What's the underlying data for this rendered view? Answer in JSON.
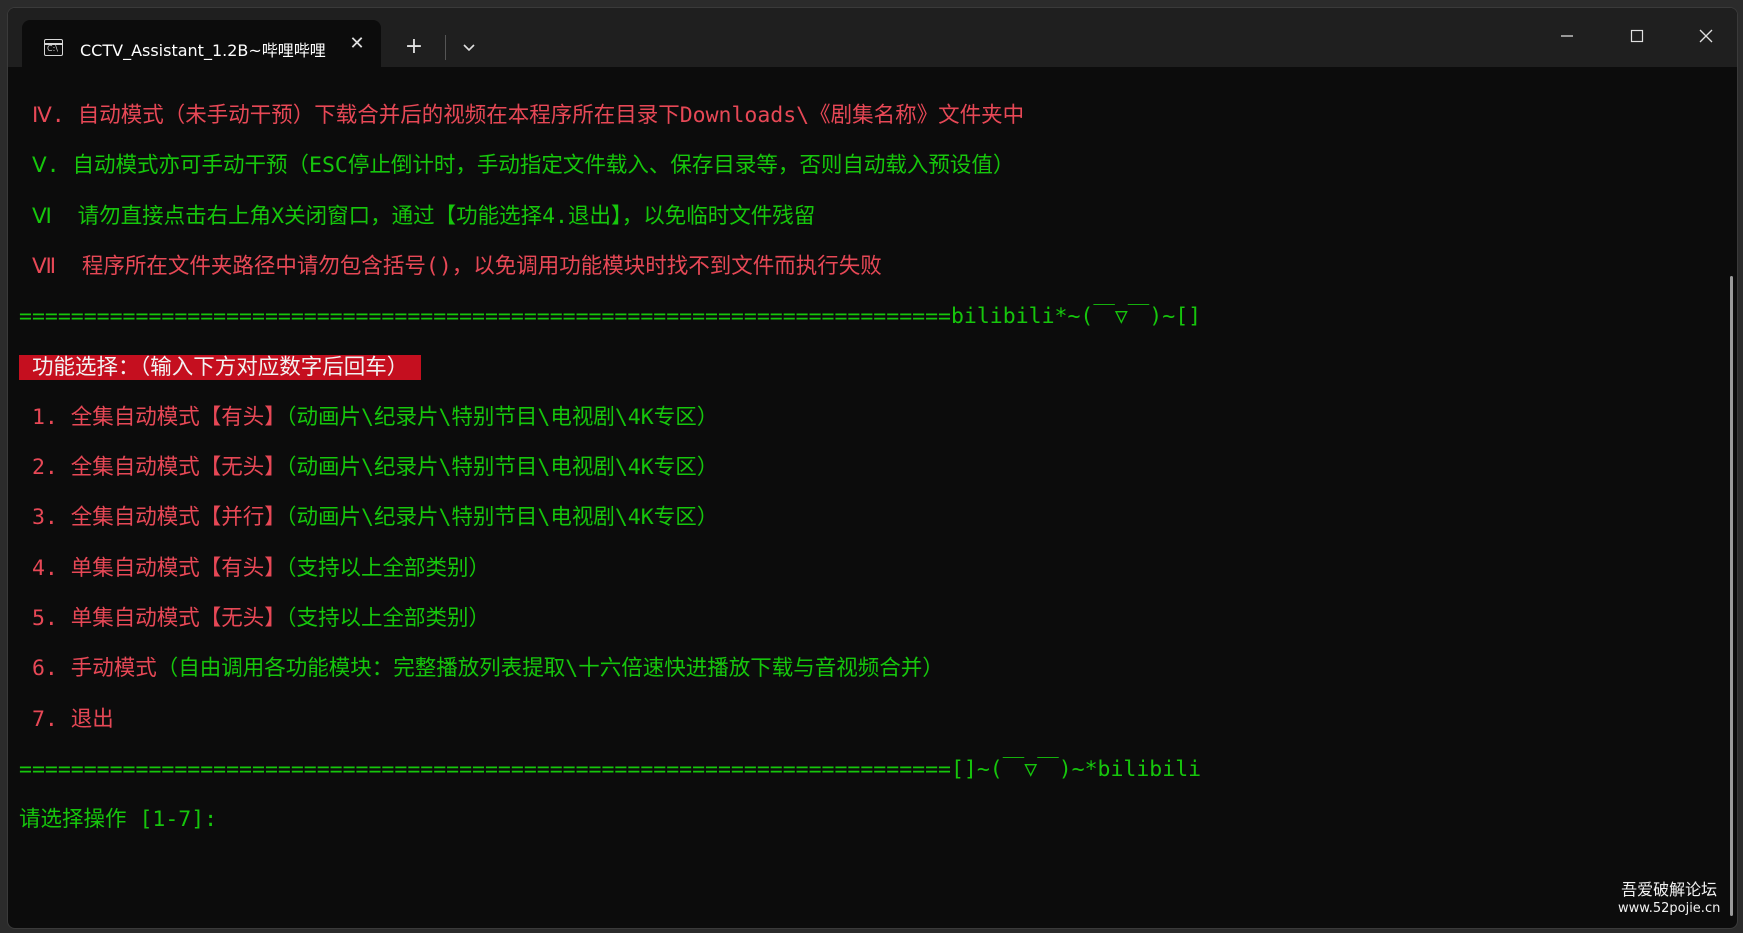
{
  "window": {
    "tab_title": "CCTV_Assistant_1.2B~哔哩哔哩",
    "tab_icon_text": "C:\\"
  },
  "terminal": {
    "lines": [
      {
        "segments": [
          {
            "text": " Ⅳ. ",
            "color": "r"
          },
          {
            "text": "自动模式（未手动干预）下载合并后的视频在本程序所在目录下Downloads\\《剧集名称》文件夹中",
            "color": "r"
          }
        ]
      },
      {
        "segments": [
          {
            "text": " Ⅴ. ",
            "color": "g"
          },
          {
            "text": "自动模式亦可手动干预（ESC停止倒计时，手动指定文件载入、保存目录等，否则自动载入预设值）",
            "color": "g"
          }
        ]
      },
      {
        "segments": [
          {
            "text": " Ⅵ  ",
            "color": "g"
          },
          {
            "text": "请勿直接点击右上角X关闭窗口，通过【功能选择4.退出】，以免临时文件残留",
            "color": "g"
          }
        ]
      },
      {
        "segments": [
          {
            "text": " Ⅶ  ",
            "color": "r"
          },
          {
            "text": "程序所在文件夹路径中请勿包含括号()，以免调用功能模块时找不到文件而执行失败",
            "color": "r"
          }
        ]
      },
      {
        "segments": [
          {
            "text": "========================================================================bilibili*~(￣▽￣)~[]",
            "color": "g"
          }
        ]
      },
      {
        "segments": [
          {
            "text": " 功能选择：（输入下方对应数字后回车） ",
            "color": "hl"
          }
        ]
      },
      {
        "segments": [
          {
            "text": " 1. 全集自动模式【有头】",
            "color": "r"
          },
          {
            "text": "（动画片\\纪录片\\特别节目\\电视剧\\4K专区）",
            "color": "g"
          }
        ]
      },
      {
        "segments": [
          {
            "text": " 2. 全集自动模式【无头】",
            "color": "r"
          },
          {
            "text": "（动画片\\纪录片\\特别节目\\电视剧\\4K专区）",
            "color": "g"
          }
        ]
      },
      {
        "segments": [
          {
            "text": " 3. 全集自动模式【并行】",
            "color": "r"
          },
          {
            "text": "（动画片\\纪录片\\特别节目\\电视剧\\4K专区）",
            "color": "g"
          }
        ]
      },
      {
        "segments": [
          {
            "text": " 4. 单集自动模式【有头】",
            "color": "r"
          },
          {
            "text": "（支持以上全部类别）",
            "color": "g"
          }
        ]
      },
      {
        "segments": [
          {
            "text": " 5. 单集自动模式【无头】",
            "color": "r"
          },
          {
            "text": "（支持以上全部类别）",
            "color": "g"
          }
        ]
      },
      {
        "segments": [
          {
            "text": " 6. 手动模式",
            "color": "r"
          },
          {
            "text": "（自由调用各功能模块：完整播放列表提取\\十六倍速快进播放下载与音视频合并）",
            "color": "g"
          }
        ]
      },
      {
        "segments": [
          {
            "text": " 7. 退出",
            "color": "r"
          }
        ]
      },
      {
        "segments": [
          {
            "text": "========================================================================[]~(￣▽￣)~*bilibili",
            "color": "g"
          }
        ]
      },
      {
        "segments": [
          {
            "text": "请选择操作 [1-7]: ",
            "color": "g"
          }
        ]
      }
    ]
  },
  "watermark": {
    "line1": "吾爱破解论坛",
    "line2": "www.52pojie.cn"
  },
  "colors": {
    "red": "#e74856",
    "green": "#16c60c",
    "highlight_bg": "#c50f1f",
    "terminal_bg": "#0c0c0c",
    "titlebar_bg": "#1f1f1f"
  }
}
